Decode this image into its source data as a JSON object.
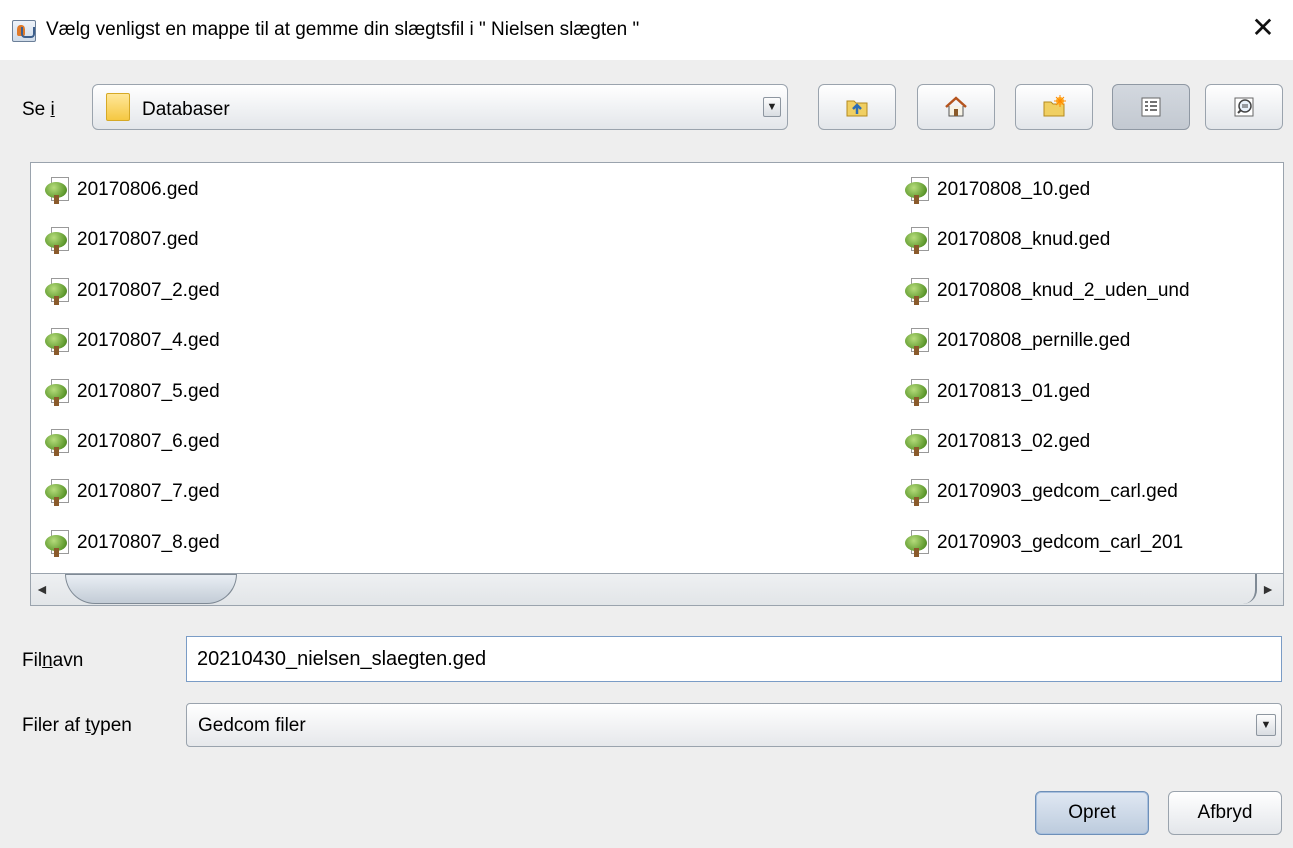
{
  "window": {
    "title": "Vælg venligst en mappe til at gemme din slægtsfil i \" Nielsen slægten \"",
    "close_glyph": "✕",
    "app_icon": "java-cup-icon"
  },
  "toolbar": {
    "lookin_prefix": "Se ",
    "lookin_mnemonic": "i",
    "folder": "Databaser",
    "folder_icon": "folder-icon",
    "dropdown_glyph": "▼",
    "buttons": [
      {
        "name": "up-one-level-button",
        "icon": "folder-up-icon"
      },
      {
        "name": "home-button",
        "icon": "home-icon"
      },
      {
        "name": "new-folder-button",
        "icon": "new-folder-icon"
      },
      {
        "name": "list-view-button",
        "icon": "list-view-icon",
        "active": true
      },
      {
        "name": "details-view-button",
        "icon": "details-view-icon"
      }
    ]
  },
  "files": {
    "column1": [
      "20170806.ged",
      "20170807.ged",
      "20170807_2.ged",
      "20170807_4.ged",
      "20170807_5.ged",
      "20170807_6.ged",
      "20170807_7.ged",
      "20170807_8.ged"
    ],
    "column2": [
      "20170808_10.ged",
      "20170808_knud.ged",
      "20170808_knud_2_uden_und",
      "20170808_pernille.ged",
      "20170813_01.ged",
      "20170813_02.ged",
      "20170903_gedcom_carl.ged",
      "20170903_gedcom_carl_201"
    ],
    "icon": "tree-file-icon"
  },
  "scrollbar": {
    "left_glyph": "◄",
    "right_glyph": "►"
  },
  "filename": {
    "label_pre": "Fil",
    "label_mnemonic": "n",
    "label_post": "avn",
    "value": "20210430_nielsen_slaegten.ged"
  },
  "filetype": {
    "label_pre": "Filer af ",
    "label_mnemonic": "t",
    "label_post": "ypen",
    "value": "Gedcom filer",
    "dropdown_glyph": "▼"
  },
  "buttons": {
    "ok": "Opret",
    "cancel": "Afbryd"
  },
  "colors": {
    "dialog_bg": "#eeeeee",
    "field_border_focus": "#7a9cc6",
    "default_button": "#bccbdd"
  }
}
